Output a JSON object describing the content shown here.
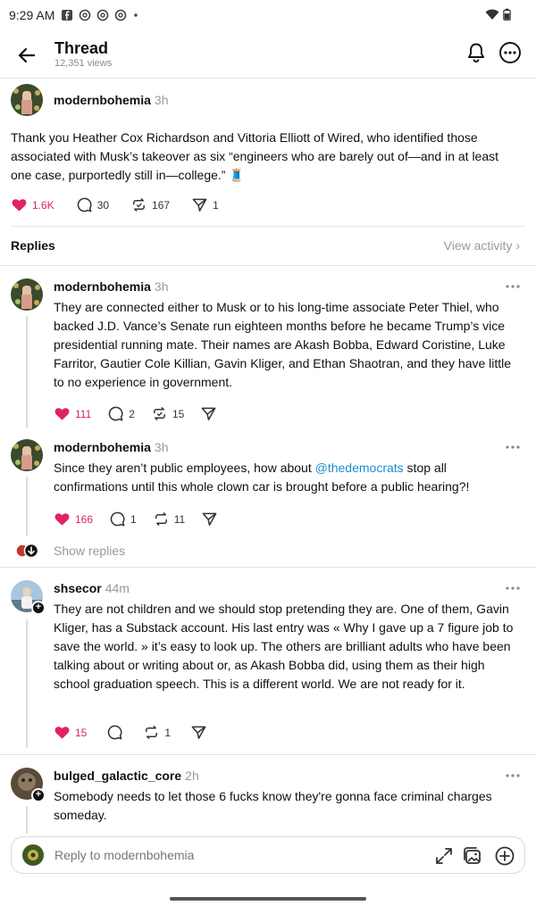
{
  "status_bar": {
    "time": "9:29 AM"
  },
  "header": {
    "title": "Thread",
    "views": "12,351 views"
  },
  "main_post": {
    "username": "modernbohemia",
    "time": "3h",
    "text": "Thank you Heather Cox Richardson and Vittoria Elliott of Wired, who identified those associated with Musk’s takeover as six “engineers who are barely out of—and in at least one case, purportedly still in—college.” 🧵",
    "likes": "1.6K",
    "comments": "30",
    "reposts": "167",
    "shares": "1"
  },
  "replies_bar": {
    "label": "Replies",
    "view_activity": "View activity"
  },
  "replies": [
    {
      "username": "modernbohemia",
      "time": "3h",
      "text": "They are connected either to Musk or to his long-time associate Peter Thiel, who backed J.D. Vance’s Senate run eighteen months before he became Trump’s vice presidential running mate. Their names are Akash Bobba, Edward Coristine, Luke Farritor, Gautier Cole Killian, Gavin Kliger, and Ethan Shaotran, and they have little to no experience in government.",
      "likes": "111",
      "comments": "2",
      "reposts": "15"
    },
    {
      "username": "modernbohemia",
      "time": "3h",
      "text_before": "Since they aren’t public employees, how about ",
      "mention": "@thedemocrats",
      "text_after": " stop all confirmations until this whole clown car is brought before a public hearing?!",
      "likes": "166",
      "comments": "1",
      "reposts": "11"
    },
    {
      "username": "shsecor",
      "time": "44m",
      "text": "They are not children and we should stop pretending they are. One of them, Gavin Kliger, has a Substack account. His last entry was « Why I gave up a 7 figure job to save the world. » it’s easy to look up. The others are brilliant adults who have been talking about or writing about or, as Akash Bobba did, using them as their high school graduation speech. This is a different world. We are not ready for it.",
      "likes": "15",
      "reposts": "1"
    },
    {
      "username": "bulged_galactic_core",
      "time": "2h",
      "text": "Somebody needs to let those 6 fucks know they're gonna face criminal charges someday."
    }
  ],
  "show_replies": "Show replies",
  "reply_box": {
    "placeholder": "Reply to modernbohemia"
  },
  "colors": {
    "like": "#e0245e",
    "mention": "#1d8bd1",
    "muted": "#999999"
  }
}
